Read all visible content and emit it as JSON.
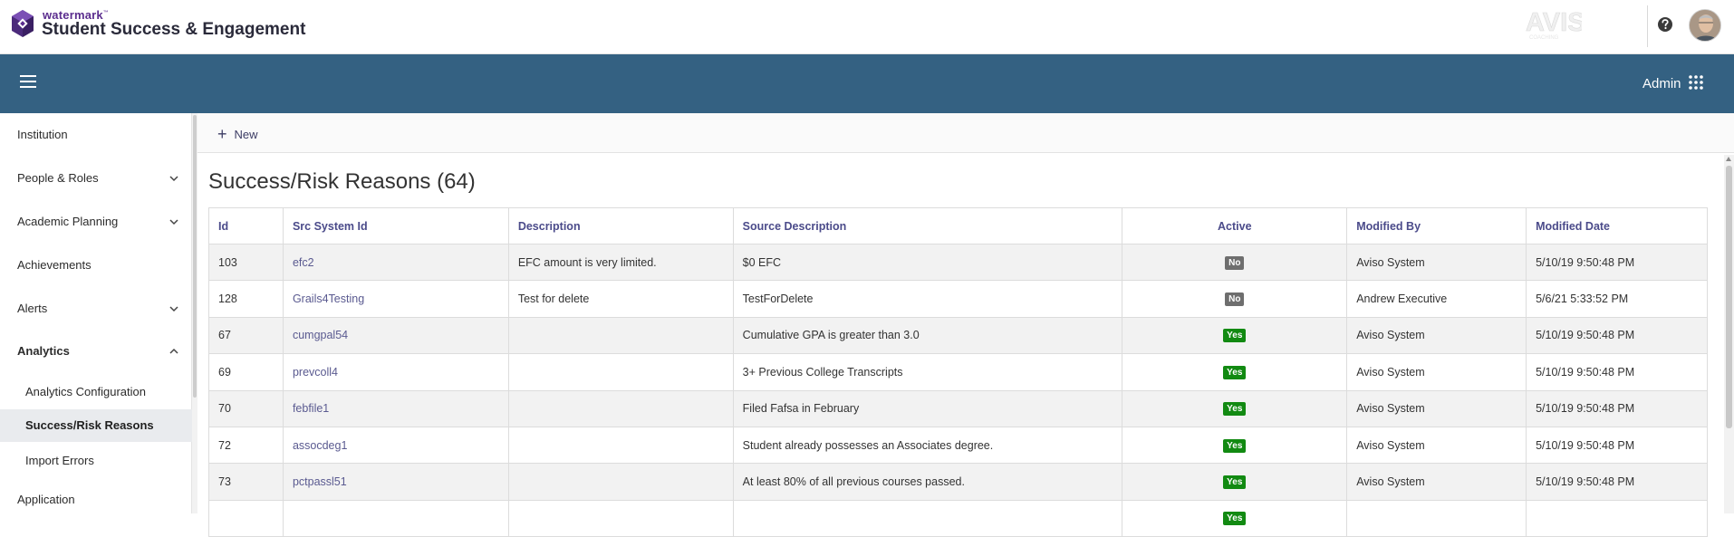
{
  "header": {
    "brand_small": "watermark",
    "brand_tm": "™",
    "brand_title": "Student Success & Engagement",
    "partner_logo": "AVISO",
    "partner_tagline": "COACHING"
  },
  "bluebar": {
    "admin_label": "Admin"
  },
  "sidebar": {
    "items": [
      {
        "label": "Institution"
      },
      {
        "label": "People & Roles"
      },
      {
        "label": "Academic Planning"
      },
      {
        "label": "Achievements"
      },
      {
        "label": "Alerts"
      },
      {
        "label": "Analytics"
      },
      {
        "label": "Analytics Configuration"
      },
      {
        "label": "Success/Risk Reasons"
      },
      {
        "label": "Import Errors"
      },
      {
        "label": "Application"
      }
    ]
  },
  "toolbar": {
    "new_label": "New"
  },
  "page": {
    "title": "Success/Risk Reasons (64)"
  },
  "table": {
    "headers": [
      "Id",
      "Src System Id",
      "Description",
      "Source Description",
      "Active",
      "Modified By",
      "Modified Date"
    ],
    "rows": [
      {
        "id": "103",
        "src": "efc2",
        "desc": "EFC amount is very limited.",
        "source_desc": "$0 EFC",
        "active": "No",
        "modified_by": "Aviso System",
        "modified_date": "5/10/19 9:50:48 PM"
      },
      {
        "id": "128",
        "src": "Grails4Testing",
        "desc": "Test for delete",
        "source_desc": "TestForDelete",
        "active": "No",
        "modified_by": "Andrew Executive",
        "modified_date": "5/6/21 5:33:52 PM"
      },
      {
        "id": "67",
        "src": "cumgpal54",
        "desc": "",
        "source_desc": "Cumulative GPA is greater than 3.0",
        "active": "Yes",
        "modified_by": "Aviso System",
        "modified_date": "5/10/19 9:50:48 PM"
      },
      {
        "id": "69",
        "src": "prevcoll4",
        "desc": "",
        "source_desc": "3+ Previous College Transcripts",
        "active": "Yes",
        "modified_by": "Aviso System",
        "modified_date": "5/10/19 9:50:48 PM"
      },
      {
        "id": "70",
        "src": "febfile1",
        "desc": "",
        "source_desc": "Filed Fafsa in February",
        "active": "Yes",
        "modified_by": "Aviso System",
        "modified_date": "5/10/19 9:50:48 PM"
      },
      {
        "id": "72",
        "src": "assocdeg1",
        "desc": "",
        "source_desc": "Student already possesses an Associates degree.",
        "active": "Yes",
        "modified_by": "Aviso System",
        "modified_date": "5/10/19 9:50:48 PM"
      },
      {
        "id": "73",
        "src": "pctpassl51",
        "desc": "",
        "source_desc": "At least 80% of all previous courses passed.",
        "active": "Yes",
        "modified_by": "Aviso System",
        "modified_date": "5/10/19 9:50:48 PM"
      },
      {
        "id": "",
        "src": "",
        "desc": "",
        "source_desc": "",
        "active": "Yes",
        "modified_by": "",
        "modified_date": ""
      }
    ]
  },
  "colors": {
    "bluebar": "#346182",
    "accent_purple": "#5b2d8e",
    "badge_yes": "#128a12",
    "badge_no": "#6e6e6e",
    "link": "#5a5a90"
  }
}
